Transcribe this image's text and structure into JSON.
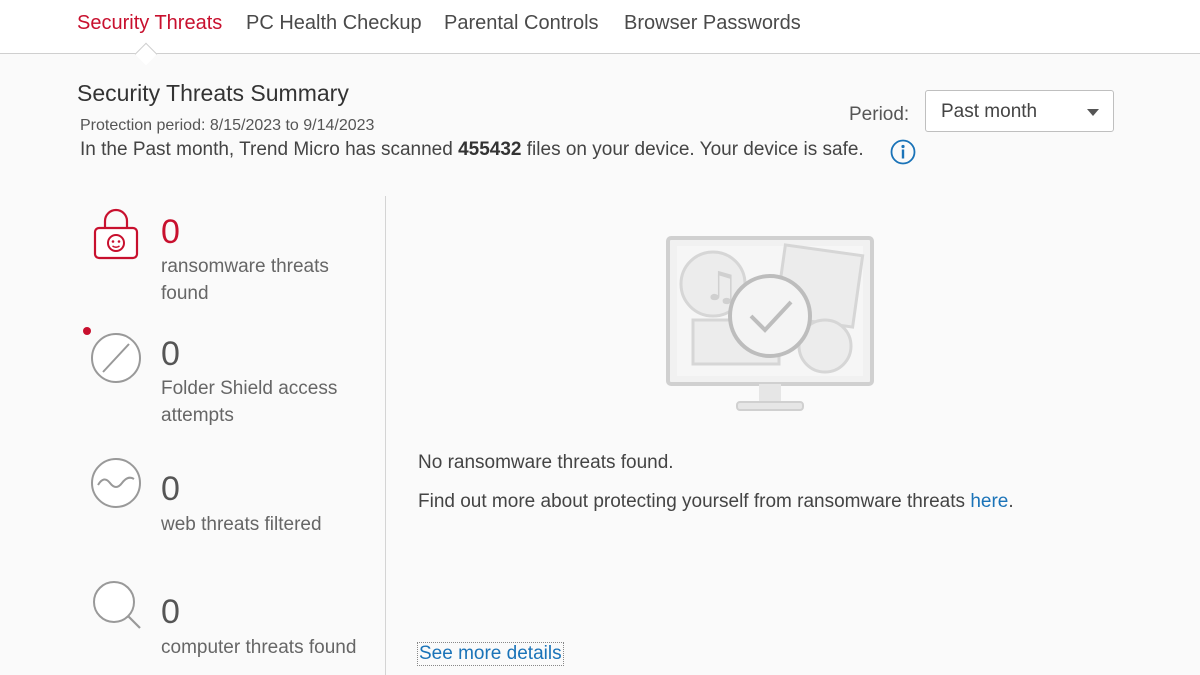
{
  "tabs": [
    {
      "label": "Security Threats",
      "active": true
    },
    {
      "label": "PC Health Checkup",
      "active": false
    },
    {
      "label": "Parental Controls",
      "active": false
    },
    {
      "label": "Browser Passwords",
      "active": false
    }
  ],
  "summary": {
    "title": "Security Threats Summary",
    "protection_period": "Protection period: 8/15/2023 to 9/14/2023",
    "scan_prefix": "In the Past month, Trend Micro has scanned ",
    "scan_count": "455432",
    "scan_suffix": " files on your device. Your device is safe.",
    "info_icon": "info-icon"
  },
  "period": {
    "label": "Period:",
    "selected": "Past month"
  },
  "stats": [
    {
      "count": "0",
      "label": "ransomware threats found",
      "icon": "lock-icon"
    },
    {
      "count": "0",
      "label": "Folder Shield access attempts",
      "icon": "blocked-icon"
    },
    {
      "count": "0",
      "label": "web threats filtered",
      "icon": "web-filter-icon"
    },
    {
      "count": "0",
      "label": "computer threats found",
      "icon": "magnifier-icon"
    }
  ],
  "detail": {
    "no_threats": "No ransomware threats found.",
    "more_prefix": "Find out more about protecting yourself from ransomware threats ",
    "more_link": "here",
    "more_suffix": ".",
    "see_more": "See more details"
  },
  "colors": {
    "accent": "#c8102e",
    "link": "#1a73b8"
  }
}
